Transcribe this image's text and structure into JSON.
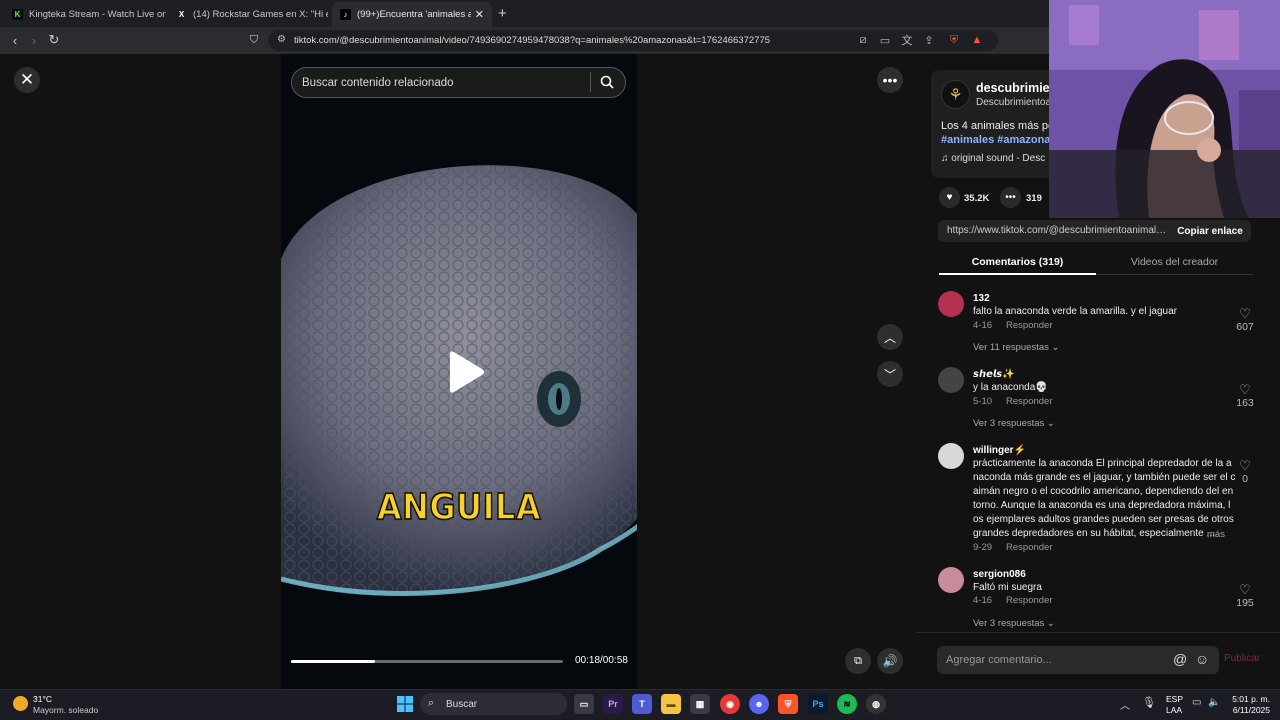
{
  "tabs": [
    {
      "title": "Kingteka Stream - Watch Live on Kick",
      "favicon_text": "K",
      "favicon_color": "#53fc18"
    },
    {
      "title": "(14) Rockstar Games en X: \"Hi everyo",
      "favicon_text": "X",
      "favicon_color": "#ffffff"
    },
    {
      "title": "(99+)Encuentra 'animales amazo",
      "favicon_text": "♪",
      "favicon_color": "#ffffff"
    }
  ],
  "url": "tiktok.com/@descubrimientoanimal/video/7493690274959478038?q=animales%20amazonas&t=1762466372775",
  "video": {
    "search_placeholder": "Buscar contenido relacionado",
    "caption": "ANGUILA",
    "time": "00:18/00:58",
    "progress": 0.31
  },
  "creator": {
    "name": "descubrimien",
    "handle": "Descubrimientoa",
    "description": "Los 4 animales más pe",
    "hashtags": "#animales #amazona",
    "sound": "original sound - Desc",
    "likes": "35.2K",
    "comments": "319"
  },
  "share": {
    "link": "https://www.tiktok.com/@descubrimientoanimal/...",
    "copy_label": "Copiar enlace"
  },
  "panel_tabs": {
    "comments": "Comentarios (319)",
    "videos": "Videos del creador"
  },
  "comments": [
    {
      "user": "132",
      "text": [
        "falto la anaconda verde la amarilla. y el jaguar"
      ],
      "date": "4-16",
      "reply": "Responder",
      "likes": "607",
      "replies": "Ver 11 respuestas",
      "avatar_color": "#b3314f"
    },
    {
      "user": "𝙨𝙝𝙚𝙡𝙨✨",
      "text": [
        "y la anaconda💀"
      ],
      "date": "5-10",
      "reply": "Responder",
      "likes": "163",
      "replies": "Ver 3 respuestas",
      "avatar_color": "#444444"
    },
    {
      "user": "willinger⚡",
      "text": [
        "prácticamente la anaconda El principal depredador de la a",
        "naconda más grande es el jaguar, y también puede ser el c",
        "aimán negro o el cocodrilo americano, dependiendo del en",
        "torno. Aunque la anaconda es una depredadora máxima, l",
        "os ejemplares adultos grandes pueden ser presas de otros",
        "grandes depredadores en su hábitat, especialmente ..."
      ],
      "more": "más",
      "date": "9-29",
      "reply": "Responder",
      "likes": "0",
      "replies": "",
      "avatar_color": "#d8d8d8"
    },
    {
      "user": "sergion086",
      "text": [
        "Faltó mi suegra"
      ],
      "date": "4-16",
      "reply": "Responder",
      "likes": "195",
      "replies": "Ver 3 respuestas",
      "avatar_color": "#c98a9a"
    }
  ],
  "comment_input": {
    "placeholder": "Agregar comentario...",
    "publish": "Publicar"
  },
  "taskbar": {
    "temp": "31°C",
    "weather": "Mayorm. soleado",
    "search": "Buscar",
    "lang_1": "ESP",
    "lang_2": "LAA",
    "time": "5:01 p. m.",
    "date": "6/11/2025"
  }
}
